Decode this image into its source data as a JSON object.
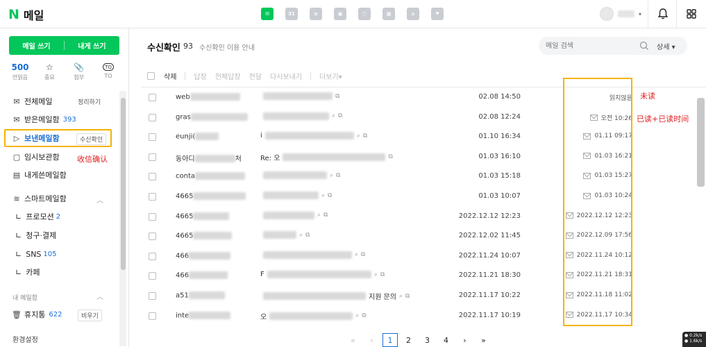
{
  "header": {
    "logo_mark": "N",
    "logo_text": "메일",
    "apps": [
      {
        "name": "mail-app-icon",
        "glyph": "✉",
        "active": true
      },
      {
        "name": "calendar-app-icon",
        "glyph": "31",
        "active": false
      },
      {
        "name": "list-app-icon",
        "glyph": "≡",
        "active": false
      },
      {
        "name": "contacts-app-icon",
        "glyph": "▣",
        "active": false
      },
      {
        "name": "cube-app-icon",
        "glyph": "⬡",
        "active": false
      },
      {
        "name": "grid-app-icon",
        "glyph": "▦",
        "active": false
      },
      {
        "name": "home-app-icon",
        "glyph": "⌂",
        "active": false
      },
      {
        "name": "flag-app-icon",
        "glyph": "⚑",
        "active": false
      }
    ]
  },
  "sidebar": {
    "compose_label": "메일 쓰기",
    "self_compose_label": "내게 쓰기",
    "quick": [
      {
        "top": "500",
        "label": "안읽음"
      },
      {
        "top": "☆",
        "label": "중요"
      },
      {
        "top": "📎",
        "label": "첨부"
      },
      {
        "top": "TO",
        "label": "TO"
      }
    ],
    "all_mail": "전체메일",
    "organize_btn": "정리하기",
    "inbox": "받은메일함",
    "inbox_count": "393",
    "sent": "보낸메일함",
    "receipt_btn": "수신확인",
    "receipt_note": "收信确认",
    "temp": "임시보관함",
    "self_box": "내게쓴메일함",
    "smart": "스마트메일함",
    "promo": "프로모션",
    "promo_count": "2",
    "billing": "청구·결제",
    "sns": "SNS",
    "sns_count": "105",
    "cafe": "카페",
    "my_mailboxes": "내 메일함",
    "trash": "휴지통",
    "trash_count": "622",
    "empty_btn": "비우기",
    "settings": "환경설정"
  },
  "main": {
    "title": "수신확인",
    "count": "93",
    "guide": "수신확인 이용 안내",
    "search_placeholder": "메일 검색",
    "detail_label": "상세",
    "toolbar": {
      "delete": "삭제",
      "reply": "답장",
      "reply_all": "전체답장",
      "forward": "전달",
      "resend": "다시보내기",
      "more": "더보기▾"
    },
    "note_unread": "未读",
    "note_read": "已读+已读时间",
    "rows": [
      {
        "sender": "web",
        "subject": "",
        "date": "02.08 14:50",
        "status": "읽지않음",
        "read": false
      },
      {
        "sender": "gras",
        "subject": "",
        "date": "02.08 12:24",
        "status": "오전 10:26",
        "read": true
      },
      {
        "sender": "eunji(",
        "subject": "i",
        "date": "01.10 16:34",
        "status": "01.11 09:17",
        "read": true
      },
      {
        "sender": "동아디",
        "subject": "Re: 오",
        "date": "01.03 16:10",
        "status": "01.03 16:21",
        "read": true
      },
      {
        "sender": "conta",
        "subject": "",
        "date": "01.03 15:18",
        "status": "01.03 15:27",
        "read": true
      },
      {
        "sender": "4665",
        "subject": "",
        "date": "01.03 10:07",
        "status": "01.03 10:24",
        "read": true
      },
      {
        "sender": "4665",
        "subject": "",
        "date": "2022.12.12 12:23",
        "status": "2022.12.12 12:23",
        "read": true
      },
      {
        "sender": "4665",
        "subject": "",
        "date": "2022.12.02 11:45",
        "status": "2022.12.09 17:56",
        "read": true
      },
      {
        "sender": "466",
        "subject": "",
        "date": "2022.11.24 10:07",
        "status": "2022.11.24 10:12",
        "read": true
      },
      {
        "sender": "466",
        "subject": "F",
        "date": "2022.11.21 18:30",
        "status": "2022.11.21 18:31",
        "read": true
      },
      {
        "sender": "a51",
        "subject": "",
        "date": "2022.11.17 10:22",
        "status": "2022.11.18 11:02",
        "read": true
      },
      {
        "sender": "inte",
        "subject": "오",
        "date": "2022.11.17 10:19",
        "status": "2022.11.17 10:34",
        "read": true
      }
    ],
    "row10_suffix": "지원 문의",
    "row4_suffix": "처",
    "pager": {
      "first": "«",
      "prev": "‹",
      "pages": [
        "1",
        "2",
        "3",
        "4"
      ],
      "next": "›",
      "last": "»"
    }
  },
  "corner_badge": "● 0.2k/s ● 1.6k/s"
}
